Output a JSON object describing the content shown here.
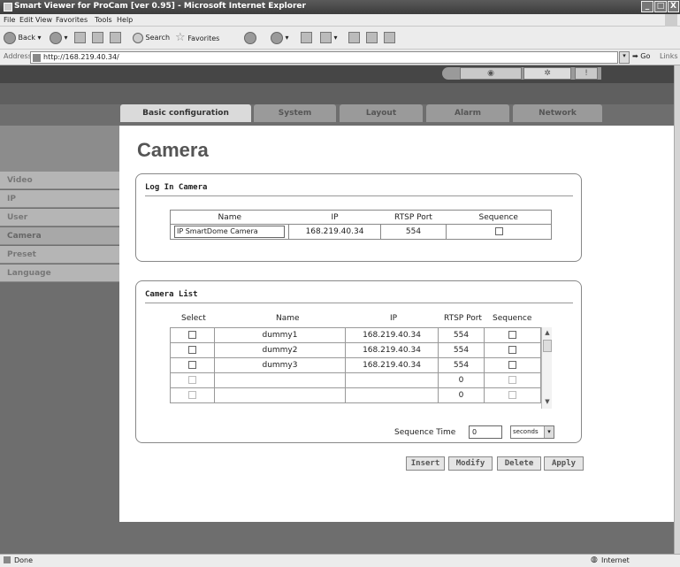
{
  "window": {
    "title": "Smart Viewer for ProCam [ver 0.95] - Microsoft Internet Explorer",
    "controls": [
      "_",
      "□",
      "X"
    ]
  },
  "menu": [
    "File",
    "Edit",
    "View",
    "Favorites",
    "Tools",
    "Help"
  ],
  "toolbar": {
    "back_label": "Back",
    "search_label": "Search",
    "favorites_label": "Favorites"
  },
  "address": {
    "label": "Address",
    "url": "http://168.219.40.34/",
    "go_label": "Go",
    "links_label": "Links"
  },
  "tabs": [
    {
      "label": "Basic configuration",
      "active": true
    },
    {
      "label": "System",
      "active": false
    },
    {
      "label": "Layout",
      "active": false
    },
    {
      "label": "Alarm",
      "active": false
    },
    {
      "label": "Network",
      "active": false
    }
  ],
  "sidebar": {
    "items": [
      {
        "label": "Video"
      },
      {
        "label": "IP"
      },
      {
        "label": "User"
      },
      {
        "label": "Camera"
      },
      {
        "label": "Preset"
      },
      {
        "label": "Language"
      }
    ]
  },
  "page_title": "Camera",
  "login_panel": {
    "title": "Log In Camera",
    "headers": [
      "Name",
      "IP",
      "RTSP Port",
      "Sequence"
    ],
    "row": {
      "name": "IP SmartDome Camera",
      "ip": "168.219.40.34",
      "port": "554",
      "sequence": false
    }
  },
  "camera_list": {
    "title": "Camera List",
    "headers": [
      "Select",
      "Name",
      "IP",
      "RTSP Port",
      "Sequence"
    ],
    "rows": [
      {
        "name": "dummy1",
        "ip": "168.219.40.34",
        "port": "554"
      },
      {
        "name": "dummy2",
        "ip": "168.219.40.34",
        "port": "554"
      },
      {
        "name": "dummy3",
        "ip": "168.219.40.34",
        "port": "554"
      },
      {
        "name": "",
        "ip": "",
        "port": "0"
      },
      {
        "name": "",
        "ip": "",
        "port": "0"
      }
    ],
    "sequence_time_label": "Sequence Time",
    "sequence_time_value": "0",
    "sequence_unit": "seconds"
  },
  "actions": {
    "insert": "Insert",
    "modify": "Modify",
    "delete": "Delete",
    "apply": "Apply"
  },
  "status": {
    "left": "Done",
    "zone": "Internet"
  },
  "colors": {
    "page_bg": "#6e6e6e",
    "tab_active": "#dadada",
    "tab_inactive": "#9a9a9a",
    "sidebar_item": "#b5b5b5"
  }
}
